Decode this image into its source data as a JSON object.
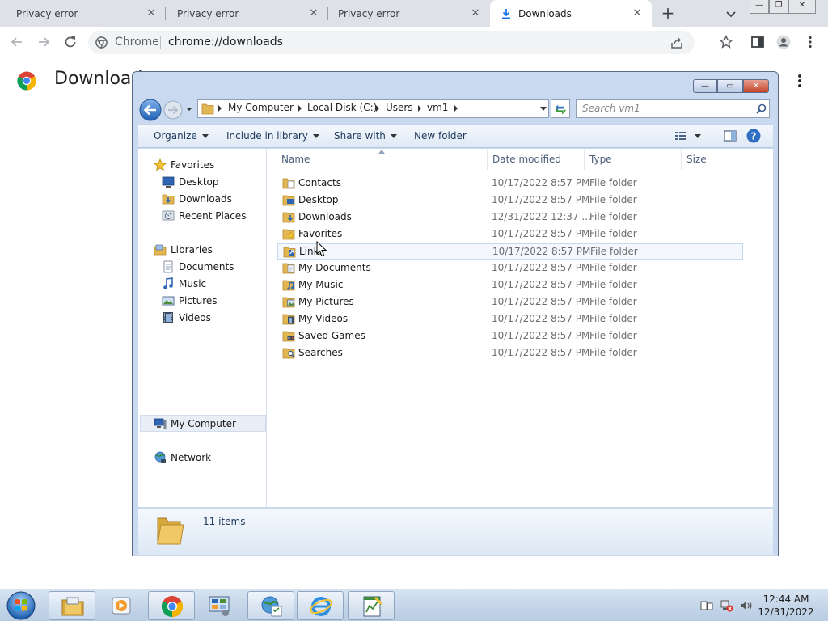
{
  "browser": {
    "tabs": [
      {
        "label": "Privacy error",
        "active": false
      },
      {
        "label": "Privacy error",
        "active": false
      },
      {
        "label": "Privacy error",
        "active": false
      },
      {
        "label": "Downloads",
        "active": true
      }
    ],
    "window_buttons": {
      "minimize": "—",
      "restore": "❐",
      "close": "✕"
    },
    "omnibox": {
      "site_label": "Chrome",
      "url": "chrome://downloads"
    },
    "accent_color": "#1a73e8"
  },
  "page": {
    "title": "Downloads"
  },
  "explorer": {
    "breadcrumb": [
      "My Computer",
      "Local Disk (C:)",
      "Users",
      "vm1"
    ],
    "search_placeholder": "Search vm1",
    "commands": {
      "organize": "Organize",
      "include_in_library": "Include in library",
      "share_with": "Share with",
      "new_folder": "New folder"
    },
    "nav": {
      "favorites": "Favorites",
      "favorites_items": [
        "Desktop",
        "Downloads",
        "Recent Places"
      ],
      "libraries": "Libraries",
      "libraries_items": [
        "Documents",
        "Music",
        "Pictures",
        "Videos"
      ],
      "computer": "My Computer",
      "network": "Network"
    },
    "columns": {
      "name": "Name",
      "date": "Date modified",
      "type": "Type",
      "size": "Size"
    },
    "files": [
      {
        "name": "Contacts",
        "date": "10/17/2022 8:57 PM",
        "type": "File folder",
        "icon": "contacts-folder-icon"
      },
      {
        "name": "Desktop",
        "date": "10/17/2022 8:57 PM",
        "type": "File folder",
        "icon": "desktop-folder-icon"
      },
      {
        "name": "Downloads",
        "date": "12/31/2022 12:37 ...",
        "type": "File folder",
        "icon": "downloads-folder-icon"
      },
      {
        "name": "Favorites",
        "date": "10/17/2022 8:57 PM",
        "type": "File folder",
        "icon": "favorites-folder-icon"
      },
      {
        "name": "Links",
        "date": "10/17/2022 8:57 PM",
        "type": "File folder",
        "icon": "links-folder-icon"
      },
      {
        "name": "My Documents",
        "date": "10/17/2022 8:57 PM",
        "type": "File folder",
        "icon": "documents-folder-icon"
      },
      {
        "name": "My Music",
        "date": "10/17/2022 8:57 PM",
        "type": "File folder",
        "icon": "music-folder-icon"
      },
      {
        "name": "My Pictures",
        "date": "10/17/2022 8:57 PM",
        "type": "File folder",
        "icon": "pictures-folder-icon"
      },
      {
        "name": "My Videos",
        "date": "10/17/2022 8:57 PM",
        "type": "File folder",
        "icon": "videos-folder-icon"
      },
      {
        "name": "Saved Games",
        "date": "10/17/2022 8:57 PM",
        "type": "File folder",
        "icon": "saved-games-folder-icon"
      },
      {
        "name": "Searches",
        "date": "10/17/2022 8:57 PM",
        "type": "File folder",
        "icon": "searches-folder-icon"
      }
    ],
    "status": {
      "item_count": "11 items"
    },
    "caption_buttons": {
      "minimize": "—",
      "maximize": "▭",
      "close": "✕"
    }
  },
  "taskbar": {
    "clock_time": "12:44 AM",
    "clock_date": "12/31/2022"
  }
}
